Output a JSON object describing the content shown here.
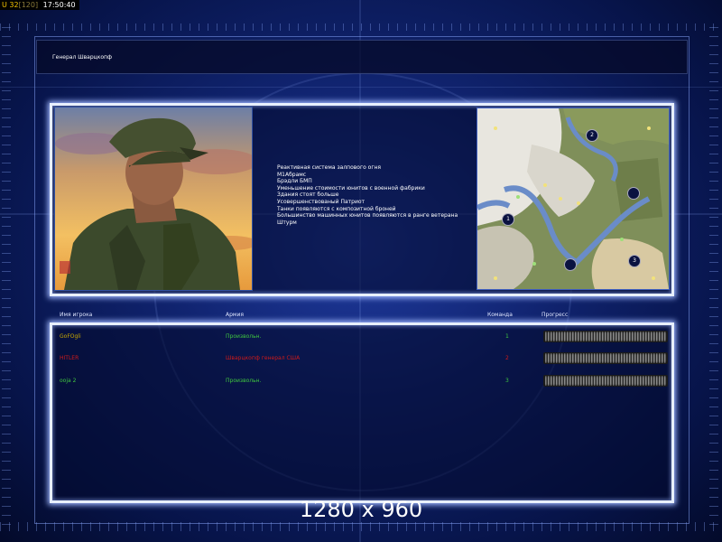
{
  "hud": {
    "fps": "U 32",
    "fps_detail": "[120]",
    "time": "17:50:40"
  },
  "general": {
    "name": "Генерал Шварцкопф"
  },
  "features": [
    "Реактивная система залпового огня",
    "М1Абрамс",
    "Брэдли БМП",
    "Уменьшение стоимости юнитов с военной фабрики",
    "Здания стоят больше",
    "Усовершенствованый Патриот",
    "Танки появляются с композитной броней",
    "Большинство машинных юнитов появляются в ранге ветерана",
    "Штурм"
  ],
  "table": {
    "headers": {
      "player": "Имя игрока",
      "army": "Армия",
      "team": "Команда",
      "progress": "Прогресс"
    },
    "rows": [
      {
        "player": "GoFOgli",
        "army": "Произвольн.",
        "team": "1",
        "color": "#c8a800",
        "army_color": "#3fc63f",
        "team_color": "#3fc63f",
        "progress": 1.0
      },
      {
        "player": "HITLER",
        "army": "Шварцкопф генерал США",
        "team": "2",
        "color": "#d01a1a",
        "army_color": "#d01a1a",
        "team_color": "#d01a1a",
        "progress": 1.0
      },
      {
        "player": "ooja 2",
        "army": "Произвольн.",
        "team": "3",
        "color": "#3fc63f",
        "army_color": "#3fc63f",
        "team_color": "#3fc63f",
        "progress": 1.0
      }
    ]
  },
  "minimap": {
    "start_positions": [
      "1",
      "2",
      "3"
    ]
  },
  "resolution_label": "1280 x 960",
  "colors": {
    "panel_glow": "#9fb8ff",
    "background": "#10236e"
  }
}
